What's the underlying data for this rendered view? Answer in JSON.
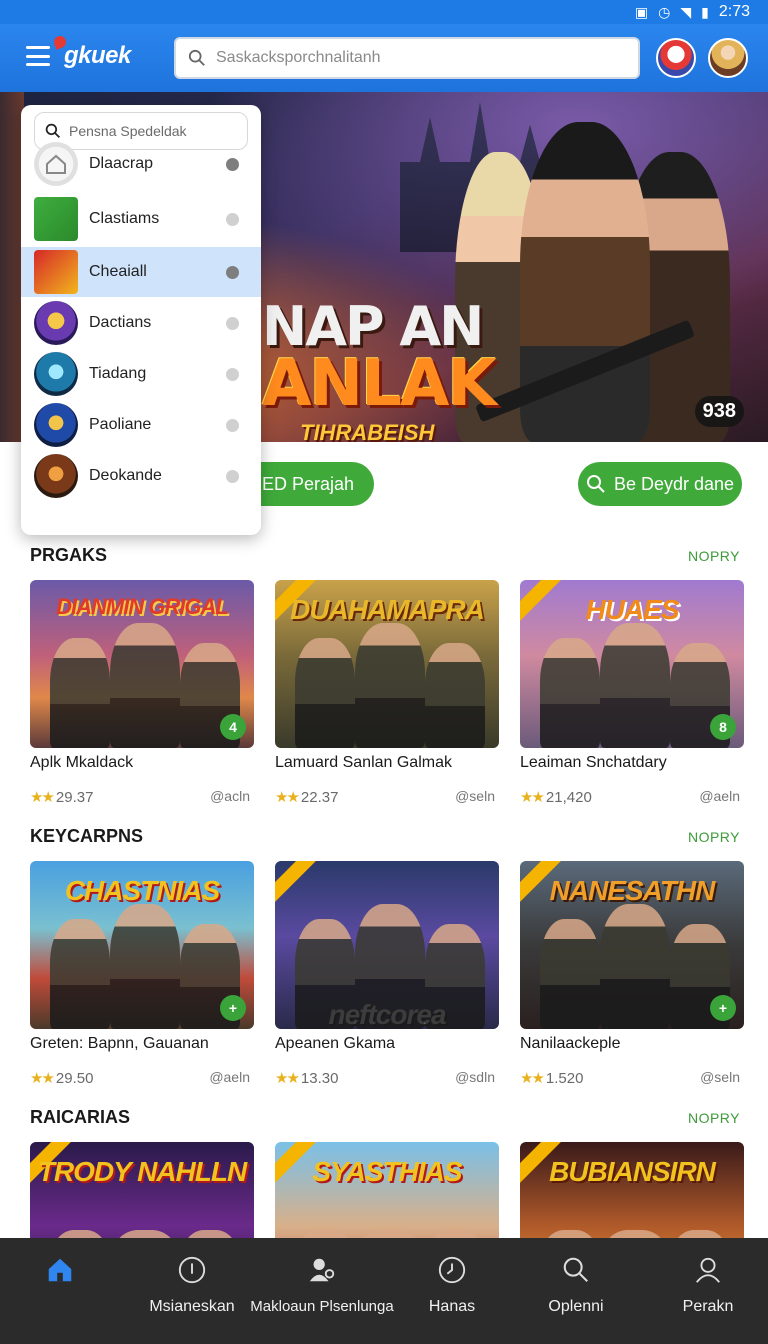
{
  "status_bar": {
    "time": "2:73"
  },
  "header": {
    "logo": "gkuek",
    "search_placeholder": "Saskacksporchnalitanh"
  },
  "hero": {
    "title_line1": "NAP AN",
    "title_line2": "ANLAK",
    "subtitle": "TIHRABEISH",
    "badge": "938"
  },
  "dropdown": {
    "search_placeholder": "Pensna Spedeldak",
    "items": [
      {
        "label": "Dlaacrap",
        "selected": false
      },
      {
        "label": "Clastiams",
        "selected": false
      },
      {
        "label": "Cheaiall",
        "selected": true
      },
      {
        "label": "Dactians",
        "selected": false
      },
      {
        "label": "Tiadang",
        "selected": false
      },
      {
        "label": "Paoliane",
        "selected": false
      },
      {
        "label": "Deokande",
        "selected": false
      }
    ]
  },
  "actions": {
    "left_pill": "ED Perajah",
    "right_pill": "Be Deydr dane"
  },
  "sections": [
    {
      "title": "PRGAKS",
      "more": "NOPRY",
      "cards": [
        {
          "thumb_title": "DIANMIN GRIGAL",
          "title": "Aplk Mkaldack",
          "rating": "29.37",
          "meta": "@acln",
          "badge": "4"
        },
        {
          "thumb_title": "DUAHAMAPRA",
          "title": "Lamuard Sanlan Galmak",
          "rating": "22.37",
          "meta": "@seln",
          "badge": ""
        },
        {
          "thumb_title": "HUAES",
          "title": "Leaiman Snchatdary",
          "rating": "21,420",
          "meta": "@aeln",
          "badge": "8"
        }
      ]
    },
    {
      "title": "KEYCARPNS",
      "more": "NOPRY",
      "cards": [
        {
          "thumb_title": "CHASTNIAS",
          "title": "Greten: Bapnn, Gauanan",
          "rating": "29.50",
          "meta": "@aeln",
          "badge": "+"
        },
        {
          "thumb_title": "neftcorea",
          "title": "Apeanen Gkama",
          "rating": "13.30",
          "meta": "@sdln",
          "badge": ""
        },
        {
          "thumb_title": "NANESATHN",
          "title": "Nanilaackeple",
          "rating": "1.520",
          "meta": "@seln",
          "badge": "+"
        }
      ]
    },
    {
      "title": "RAICARIAS",
      "more": "NOPRY",
      "cards": [
        {
          "thumb_title": "TRODY NAHLLN",
          "title": "",
          "rating": "",
          "meta": "",
          "badge": ""
        },
        {
          "thumb_title": "SYASTHIAS",
          "title": "",
          "rating": "",
          "meta": "",
          "badge": ""
        },
        {
          "thumb_title": "BUBIANSIRN",
          "title": "",
          "rating": "",
          "meta": "",
          "badge": ""
        }
      ]
    }
  ],
  "bottom_nav": [
    {
      "label": "",
      "icon": "home-icon",
      "active": true
    },
    {
      "label": "Msianeskan",
      "icon": "info-icon",
      "active": false
    },
    {
      "label": "Makloaun Plsenlunga",
      "icon": "user-pin-icon",
      "active": false
    },
    {
      "label": "Hanas",
      "icon": "clock-icon",
      "active": false
    },
    {
      "label": "Oplenni",
      "icon": "search-icon",
      "active": false
    },
    {
      "label": "Perakn",
      "icon": "profile-icon",
      "active": false
    }
  ],
  "colors": {
    "primary": "#1f73dc",
    "accent_green": "#3faa3a",
    "nav_bg": "#2b2b2b"
  }
}
